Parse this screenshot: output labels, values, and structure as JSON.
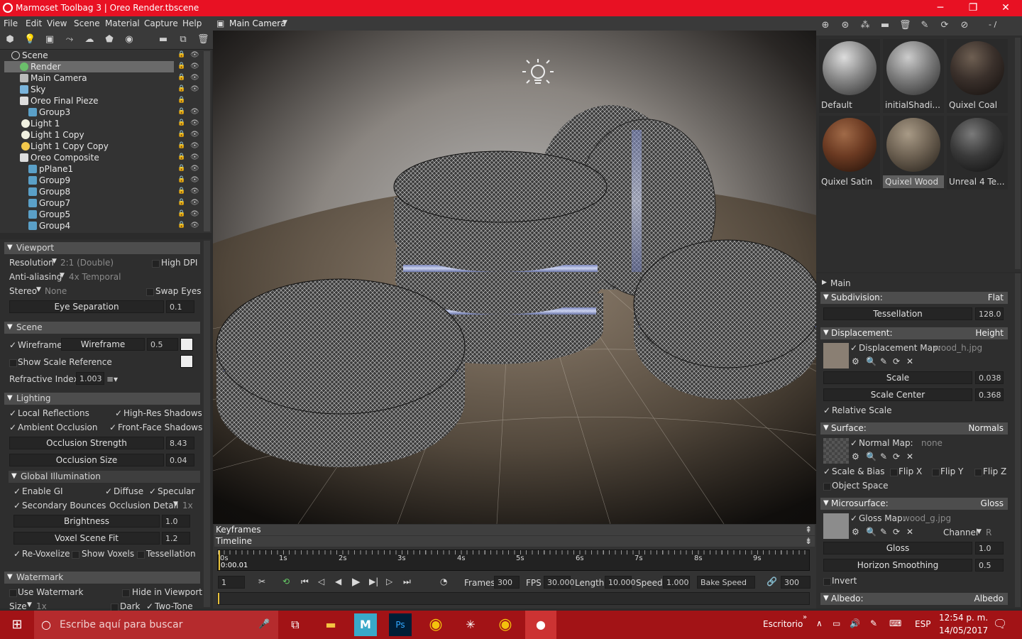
{
  "window": {
    "title": "Marmoset Toolbag 3  |  Oreo Render.tbscene",
    "accent": "#e81123"
  },
  "menu": [
    "File",
    "Edit",
    "View",
    "Scene",
    "Material",
    "Capture",
    "Help"
  ],
  "scene_tree": [
    {
      "label": "Scene",
      "indent": 0
    },
    {
      "label": "Render",
      "indent": 1,
      "selected": true
    },
    {
      "label": "Main Camera",
      "indent": 1
    },
    {
      "label": "Sky",
      "indent": 1
    },
    {
      "label": "Oreo Final Pieze",
      "indent": 1
    },
    {
      "label": "Group3",
      "indent": 2
    },
    {
      "label": "Light 1",
      "indent": 2
    },
    {
      "label": "Light 1 Copy",
      "indent": 2
    },
    {
      "label": "Light 1 Copy Copy",
      "indent": 2
    },
    {
      "label": "Oreo Composite",
      "indent": 1
    },
    {
      "label": "pPlane1",
      "indent": 2
    },
    {
      "label": "Group9",
      "indent": 2
    },
    {
      "label": "Group8",
      "indent": 2
    },
    {
      "label": "Group7",
      "indent": 2
    },
    {
      "label": "Group5",
      "indent": 2
    },
    {
      "label": "Group4",
      "indent": 2
    }
  ],
  "viewport_section": {
    "title": "Viewport",
    "resolution_label": "Resolution",
    "resolution_value": "2:1 (Double)",
    "high_dpi": "High DPI",
    "aa_label": "Anti-aliasing",
    "aa_value": "4x Temporal",
    "stereo_label": "Stereo",
    "stereo_value": "None",
    "swap_eyes": "Swap Eyes",
    "eye_sep_label": "Eye Separation",
    "eye_sep_value": "0.1"
  },
  "scene_section": {
    "title": "Scene",
    "wireframe": "Wireframe",
    "wireframe_slider": "Wireframe",
    "wireframe_value": "0.5",
    "show_scale": "Show Scale Reference",
    "refr_label": "Refractive Index:",
    "refr_value": "1.003"
  },
  "lighting_section": {
    "title": "Lighting",
    "local_refl": "Local Reflections",
    "high_res": "High-Res Shadows",
    "ao": "Ambient Occlusion",
    "front_face": "Front-Face Shadows",
    "occ_strength": "Occlusion Strength",
    "occ_strength_value": "8.43",
    "occ_size": "Occlusion Size",
    "occ_size_value": "0.04",
    "gi_title": "Global Illumination",
    "enable_gi": "Enable GI",
    "diffuse": "Diffuse",
    "specular": "Specular",
    "sec_bounces": "Secondary Bounces",
    "occ_detail": "Occlusion Detail",
    "occ_detail_value": "1x",
    "brightness": "Brightness",
    "brightness_value": "1.0",
    "voxel_fit": "Voxel Scene Fit",
    "voxel_fit_value": "1.2",
    "revoxelize": "Re-Voxelize",
    "show_voxels": "Show Voxels",
    "tessellation": "Tessellation"
  },
  "watermark_section": {
    "title": "Watermark",
    "use": "Use Watermark",
    "hide": "Hide in Viewport",
    "size": "Size",
    "size_value": "1x",
    "dark": "Dark",
    "two_tone": "Two-Tone"
  },
  "viewport": {
    "camera": "Main Camera"
  },
  "timeline": {
    "keyframes": "Keyframes",
    "timeline": "Timeline",
    "ticks": [
      "0s",
      "1s",
      "2s",
      "3s",
      "4s",
      "5s",
      "6s",
      "7s",
      "8s",
      "9s"
    ],
    "time": "0:00.01",
    "frame": "1",
    "frames_label": "Frames",
    "frames_value": "300",
    "fps_label": "FPS",
    "fps_value": "30.000",
    "length_label": "Length",
    "length_value": "10.000",
    "speed_label": "Speed",
    "speed_value": "1.000",
    "bake_speed": "Bake Speed",
    "link_value": "300"
  },
  "materials": {
    "counter": "- /",
    "items": [
      {
        "name": "Default",
        "color": "#8a8a8a"
      },
      {
        "name": "initialShadi...",
        "color": "#7d7d7d"
      },
      {
        "name": "Quixel Coal",
        "color": "#3a302b"
      },
      {
        "name": "Quixel Satin",
        "color": "#6b3a22"
      },
      {
        "name": "Quixel Wood",
        "color": "#6e6253",
        "selected": true
      },
      {
        "name": "Unreal 4 Te...",
        "color": "#3a3a3a"
      }
    ]
  },
  "mat_props": {
    "main": "Main",
    "subdivision": "Subdivision:",
    "subdivision_mode": "Flat",
    "tessellation": "Tessellation",
    "tessellation_value": "128.0",
    "displacement": "Displacement:",
    "displacement_mode": "Height",
    "disp_map_label": "Displacement Map:",
    "disp_map_file": "wood_h.jpg",
    "scale": "Scale",
    "scale_value": "0.038",
    "scale_center": "Scale Center",
    "scale_center_value": "0.368",
    "relative_scale": "Relative Scale",
    "surface": "Surface:",
    "surface_mode": "Normals",
    "normal_map_label": "Normal Map:",
    "normal_map_file": "none",
    "scale_bias": "Scale & Bias",
    "flip_x": "Flip X",
    "flip_y": "Flip Y",
    "flip_z": "Flip Z",
    "object_space": "Object Space",
    "microsurface": "Microsurface:",
    "microsurface_mode": "Gloss",
    "gloss_map_label": "Gloss Map:",
    "gloss_map_file": "wood_g.jpg",
    "channel": "Channel",
    "channel_value": "R",
    "gloss": "Gloss",
    "gloss_value": "1.0",
    "horizon": "Horizon Smoothing",
    "horizon_value": "0.5",
    "invert": "Invert",
    "albedo": "Albedo:",
    "albedo_mode": "Albedo"
  },
  "taskbar": {
    "search_placeholder": "Escribe aquí para buscar",
    "desktop": "Escritorio",
    "lang": "ESP",
    "time": "12:54 p. m.",
    "date": "14/05/2017",
    "color": "#a21316"
  }
}
